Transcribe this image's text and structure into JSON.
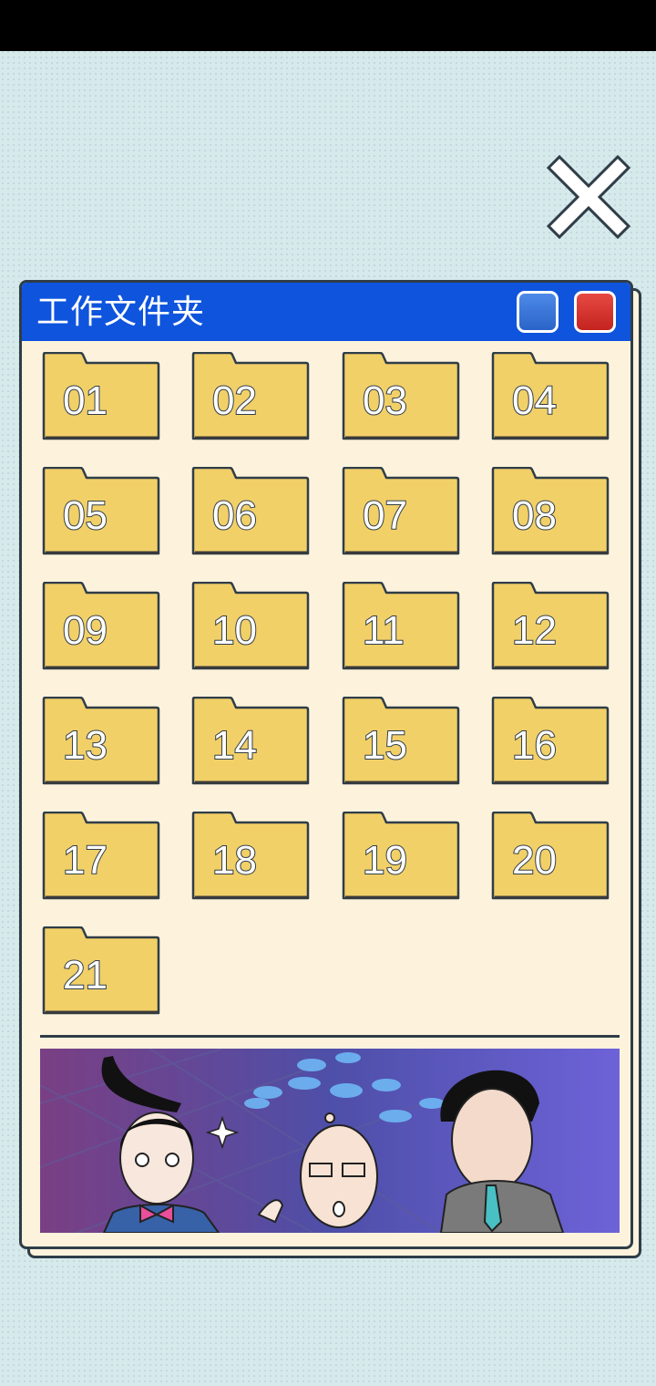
{
  "window": {
    "title": "工作文件夹"
  },
  "folders": [
    {
      "label": "01"
    },
    {
      "label": "02"
    },
    {
      "label": "03"
    },
    {
      "label": "04"
    },
    {
      "label": "05"
    },
    {
      "label": "06"
    },
    {
      "label": "07"
    },
    {
      "label": "08"
    },
    {
      "label": "09"
    },
    {
      "label": "10"
    },
    {
      "label": "11"
    },
    {
      "label": "12"
    },
    {
      "label": "13"
    },
    {
      "label": "14"
    },
    {
      "label": "15"
    },
    {
      "label": "16"
    },
    {
      "label": "17"
    },
    {
      "label": "18"
    },
    {
      "label": "19"
    },
    {
      "label": "20"
    },
    {
      "label": "21"
    }
  ],
  "colors": {
    "titlebar": "#0e54dd",
    "folder": "#f2d068",
    "window_bg": "#fdf3dc",
    "page_bg": "#d6eaec"
  },
  "icons": {
    "close": "close-icon",
    "folder": "folder-icon"
  }
}
